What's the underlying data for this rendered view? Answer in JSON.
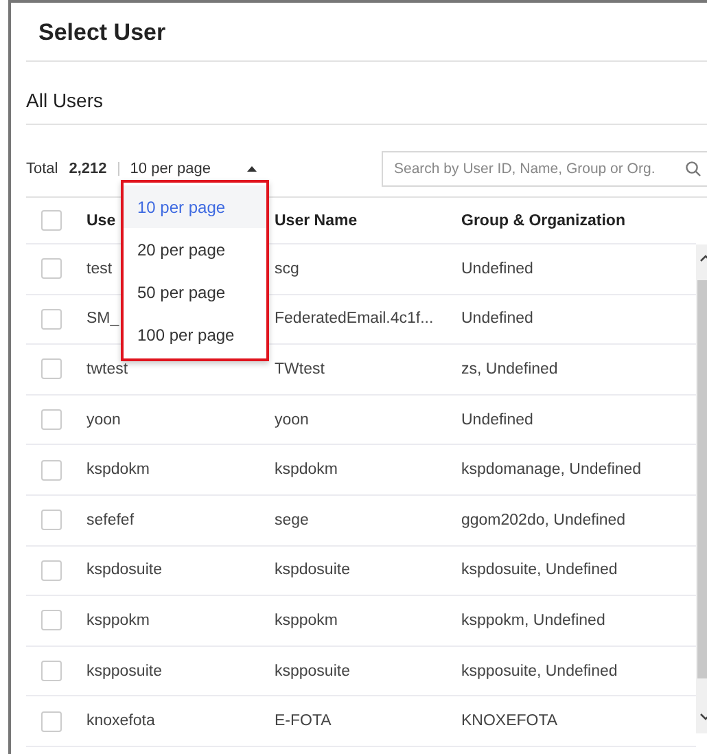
{
  "dialog": {
    "title": "Select User"
  },
  "section": {
    "title": "All Users"
  },
  "toolbar": {
    "total_label": "Total",
    "total_count": "2,212",
    "page_size": "10 per page",
    "search": {
      "placeholder": "Search by User ID, Name, Group or Org."
    }
  },
  "page_size_menu": {
    "expanded": true,
    "items": [
      {
        "label": "10 per page",
        "selected": true
      },
      {
        "label": "20 per page",
        "selected": false
      },
      {
        "label": "50 per page",
        "selected": false
      },
      {
        "label": "100 per page",
        "selected": false
      }
    ]
  },
  "table": {
    "select_all": {
      "checked": false
    },
    "columns": [
      "Use",
      "User Name",
      "Group & Organization"
    ],
    "rows": [
      {
        "checked": false,
        "cells": [
          "test",
          "scg",
          "Undefined"
        ]
      },
      {
        "checked": false,
        "cells": [
          "SM_",
          "FederatedEmail.4c1f...",
          "Undefined"
        ]
      },
      {
        "checked": false,
        "cells": [
          "twtest",
          "TWtest",
          "zs, Undefined"
        ]
      },
      {
        "checked": false,
        "cells": [
          "yoon",
          "yoon",
          "Undefined"
        ]
      },
      {
        "checked": false,
        "cells": [
          "kspdokm",
          "kspdokm",
          "kspdomanage, Undefined"
        ]
      },
      {
        "checked": false,
        "cells": [
          "sefefef",
          "sege",
          "ggom202do, Undefined"
        ]
      },
      {
        "checked": false,
        "cells": [
          "kspdosuite",
          "kspdosuite",
          "kspdosuite, Undefined"
        ]
      },
      {
        "checked": false,
        "cells": [
          "ksppokm",
          "ksppokm",
          "ksppokm, Undefined"
        ]
      },
      {
        "checked": false,
        "cells": [
          "kspposuite",
          "kspposuite",
          "kspposuite, Undefined"
        ]
      },
      {
        "checked": false,
        "cells": [
          "knoxefota",
          "E-FOTA",
          "KNOXEFOTA"
        ]
      }
    ]
  }
}
